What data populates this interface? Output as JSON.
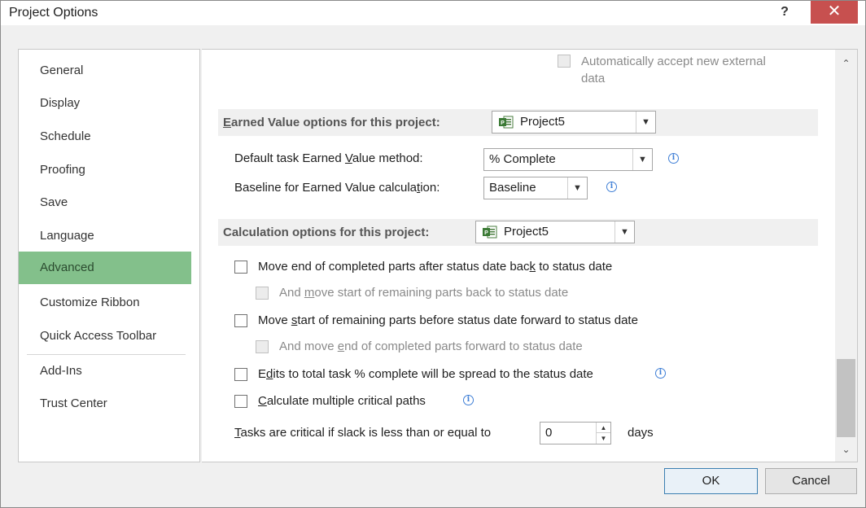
{
  "window": {
    "title": "Project Options",
    "help": "?",
    "close": "✕"
  },
  "nav": {
    "items": [
      {
        "label": "General"
      },
      {
        "label": "Display"
      },
      {
        "label": "Schedule"
      },
      {
        "label": "Proofing"
      },
      {
        "label": "Save"
      },
      {
        "label": "Language"
      },
      {
        "label": "Advanced"
      },
      {
        "label": "Customize Ribbon"
      },
      {
        "label": "Quick Access Toolbar"
      },
      {
        "label": "Add-Ins"
      },
      {
        "label": "Trust Center"
      }
    ],
    "active_item": "Advanced"
  },
  "content": {
    "auto_accept": {
      "line1": "Automatically accept new external",
      "line2": "data",
      "checked": false,
      "enabled": false
    },
    "earned_value": {
      "header": "Earned Value options for this project:",
      "project": "Project5",
      "method_label": "Default task Earned Value method:",
      "method_value": "% Complete",
      "baseline_label": "Baseline for Earned Value calculation:",
      "baseline_value": "Baseline"
    },
    "calculation": {
      "header": "Calculation options for this project:",
      "project": "Project5",
      "opt1": {
        "label": "Move end of completed parts after status date back to status date",
        "checked": false
      },
      "opt1a": {
        "label": "And move start of remaining parts back to status date",
        "checked": false,
        "enabled": false
      },
      "opt2": {
        "label": "Move start of remaining parts before status date forward to status date",
        "checked": false
      },
      "opt2a": {
        "label": "And move end of completed parts forward to status date",
        "checked": false,
        "enabled": false
      },
      "opt3": {
        "label": "Edits to total task % complete will be spread to the status date",
        "checked": false
      },
      "opt4": {
        "label": "Calculate multiple critical paths",
        "checked": false
      },
      "slack_label": "Tasks are critical if slack is less than or equal to",
      "slack_value": "0",
      "slack_unit": "days"
    }
  },
  "footer": {
    "ok": "OK",
    "cancel": "Cancel"
  },
  "colors": {
    "active_nav": "#83c08b",
    "close_button": "#c7504f",
    "info_icon": "#3f7fd6"
  }
}
